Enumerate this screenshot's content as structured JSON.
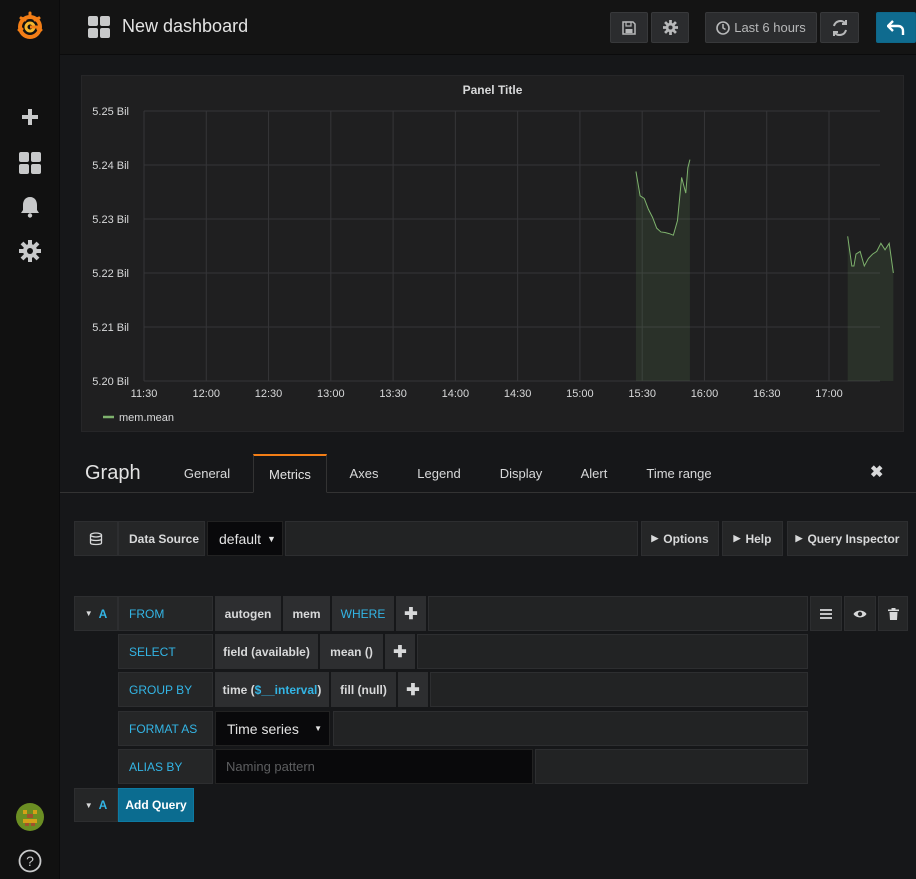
{
  "topnav": {
    "dashboard_title": "New dashboard",
    "time_range_label": "Last 6 hours"
  },
  "panel": {
    "title": "Panel Title",
    "chart_data": {
      "type": "line",
      "title": "Panel Title",
      "x_tick_labels": [
        "11:30",
        "12:00",
        "12:30",
        "13:00",
        "13:30",
        "14:00",
        "14:30",
        "15:00",
        "15:30",
        "16:00",
        "16:30",
        "17:00"
      ],
      "y_tick_labels": [
        "5.20 Bil",
        "5.21 Bil",
        "5.22 Bil",
        "5.23 Bil",
        "5.24 Bil",
        "5.25 Bil"
      ],
      "ylim": [
        5.2,
        5.25
      ],
      "series": [
        {
          "name": "mem.mean",
          "color": "#7eb26d",
          "segments": [
            [
              [
                "15:27",
                5.2388
              ],
              [
                "15:29",
                5.2343
              ],
              [
                "15:31",
                5.2338
              ],
              [
                "15:33",
                5.2318
              ],
              [
                "15:35",
                5.2303
              ],
              [
                "15:37",
                5.2283
              ],
              [
                "15:39",
                5.2276
              ],
              [
                "15:41",
                5.2275
              ],
              [
                "15:43",
                5.2273
              ],
              [
                "15:45",
                5.227
              ],
              [
                "15:47",
                5.2297
              ],
              [
                "15:49",
                5.2377
              ],
              [
                "15:51",
                5.2348
              ],
              [
                "15:52",
                5.2395
              ],
              [
                "15:53",
                5.241
              ]
            ],
            [
              [
                "17:09",
                5.2268
              ],
              [
                "17:11",
                5.2213
              ],
              [
                "17:12",
                5.2213
              ],
              [
                "17:13",
                5.2235
              ],
              [
                "17:15",
                5.224
              ],
              [
                "17:17",
                5.2213
              ],
              [
                "17:19",
                5.2227
              ],
              [
                "17:21",
                5.2235
              ],
              [
                "17:23",
                5.224
              ],
              [
                "17:25",
                5.2255
              ],
              [
                "17:27",
                5.2243
              ],
              [
                "17:29",
                5.2255
              ],
              [
                "17:31",
                5.22
              ]
            ]
          ]
        }
      ],
      "grid": true,
      "legend": "bottom-left"
    }
  },
  "editor": {
    "title": "Graph",
    "tabs": [
      "General",
      "Metrics",
      "Axes",
      "Legend",
      "Display",
      "Alert",
      "Time range"
    ],
    "active_tab": "Metrics",
    "datasource": {
      "label": "Data Source",
      "value": "default",
      "options_label": "Options",
      "help_label": "Help",
      "inspector_label": "Query Inspector"
    },
    "query": {
      "ref_id": "A",
      "from_kw": "FROM",
      "policy": "autogen",
      "measurement": "mem",
      "where_kw": "WHERE",
      "select_kw": "SELECT",
      "select_field": "field (available)",
      "select_func": "mean ()",
      "group_kw": "GROUP BY",
      "group_time_prefix": "time (",
      "group_time_var": "$__interval",
      "group_time_suffix": ")",
      "group_fill": "fill (null)",
      "format_kw": "FORMAT AS",
      "format_value": "Time series",
      "alias_kw": "ALIAS BY",
      "alias_placeholder": "Naming pattern"
    },
    "add_query_ref": "A",
    "add_query_label": "Add Query"
  },
  "icons": [
    "grafana-logo-icon",
    "plus-icon",
    "dashboards-icon",
    "bell-icon",
    "gear-icon",
    "user-avatar",
    "help-icon",
    "save-icon",
    "settings-icon",
    "clock-icon",
    "refresh-icon",
    "back-icon",
    "database-icon",
    "caret-right-icon",
    "caret-down-icon",
    "hamburger-icon",
    "eye-icon",
    "trash-icon",
    "close-icon"
  ]
}
